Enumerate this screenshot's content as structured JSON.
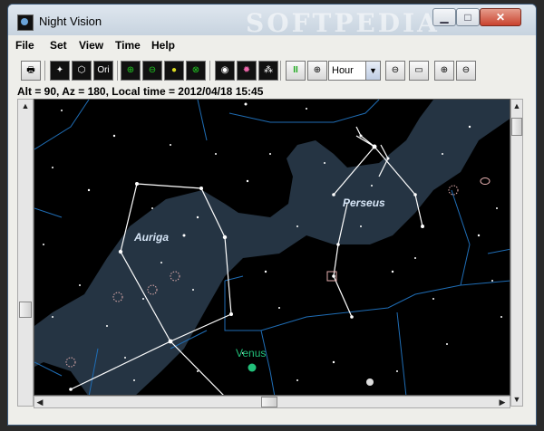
{
  "window": {
    "title": "Night Vision",
    "watermark": "SOFTPEDIA"
  },
  "menu": [
    "File",
    "Set",
    "View",
    "Time",
    "Help"
  ],
  "toolbar": {
    "ori_label": "Ori",
    "time_unit": "Hour",
    "pause_label": "II"
  },
  "status": {
    "text": "Alt = 90, Az = 180, Local time = 2012/04/18 15:45"
  },
  "sky": {
    "constellations": [
      "Auriga",
      "Perseus"
    ],
    "planet": "Venus",
    "colors": {
      "background": "#000000",
      "milky_way": "#2b3d4f",
      "constellation_line": "#ffffff",
      "boundary": "#1f6db5",
      "planet": "#22c07a",
      "deep_sky": "#e6b0b0"
    }
  },
  "icons": [
    "print-icon",
    "constellation-lines-icon",
    "constellation-boundaries-icon",
    "grid-icon",
    "equator-icon",
    "ecliptic-icon",
    "horizon-icon",
    "galaxy-icon",
    "nebula-icon",
    "cluster-icon",
    "pause-icon",
    "crosshair-icon",
    "minus-circle-icon",
    "monitor-icon",
    "zoom-in-icon",
    "zoom-out-icon"
  ]
}
